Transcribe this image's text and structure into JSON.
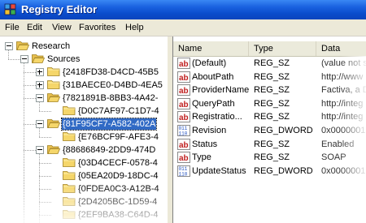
{
  "window": {
    "title": "Registry Editor"
  },
  "menu": [
    "File",
    "Edit",
    "View",
    "Favorites",
    "Help"
  ],
  "tree": [
    {
      "label": "Research",
      "level": 0,
      "expander": "minus"
    },
    {
      "label": "Sources",
      "level": 1,
      "expander": "minus"
    },
    {
      "label": "{2418FD38-D4CD-45B5",
      "level": 2,
      "expander": "plus"
    },
    {
      "label": "{31BAECE0-D4BD-4EA5",
      "level": 2,
      "expander": "plus"
    },
    {
      "label": "{7821891B-8BB3-4A42-",
      "level": 2,
      "expander": "minus"
    },
    {
      "label": "{D0C7AF97-C1D7-4",
      "level": 3,
      "expander": "none"
    },
    {
      "label": "{81F95CF7-A582-402A",
      "level": 2,
      "expander": "minus",
      "selected": true
    },
    {
      "label": "{E76BCF9F-AFE3-4",
      "level": 3,
      "expander": "none"
    },
    {
      "label": "{88686849-2DD9-474D",
      "level": 2,
      "expander": "minus"
    },
    {
      "label": "{03D4CECF-0578-4",
      "level": 3,
      "expander": "none"
    },
    {
      "label": "{05EA20D9-18DC-4",
      "level": 3,
      "expander": "none"
    },
    {
      "label": "{0FDEA0C3-A12B-4",
      "level": 3,
      "expander": "none"
    },
    {
      "label": "{2D4205BC-1D59-4",
      "level": 3,
      "expander": "none"
    },
    {
      "label": "{2EF9BA38-C64D-4",
      "level": 3,
      "expander": "none"
    }
  ],
  "columns": {
    "name": "Name",
    "type": "Type",
    "data": "Data"
  },
  "values": [
    {
      "name": "(Default)",
      "type": "REG_SZ",
      "data": "(value not s",
      "icon": "string-value-icon"
    },
    {
      "name": "AboutPath",
      "type": "REG_SZ",
      "data": "http://www",
      "icon": "string-value-icon"
    },
    {
      "name": "ProviderName",
      "type": "REG_SZ",
      "data": "Factiva, a D",
      "icon": "string-value-icon"
    },
    {
      "name": "QueryPath",
      "type": "REG_SZ",
      "data": "http://integ",
      "icon": "string-value-icon"
    },
    {
      "name": "Registratio...",
      "type": "REG_SZ",
      "data": "http://integ",
      "icon": "string-value-icon"
    },
    {
      "name": "Revision",
      "type": "REG_DWORD",
      "data": "0x0000001",
      "icon": "binary-value-icon"
    },
    {
      "name": "Status",
      "type": "REG_SZ",
      "data": "Enabled",
      "icon": "string-value-icon"
    },
    {
      "name": "Type",
      "type": "REG_SZ",
      "data": "SOAP",
      "icon": "string-value-icon"
    },
    {
      "name": "UpdateStatus",
      "type": "REG_DWORD",
      "data": "0x0000001",
      "icon": "binary-value-icon"
    }
  ],
  "colors": {
    "title_bar": "#0a4ccc",
    "selection": "#316ac5",
    "folder": "#f5d66a"
  }
}
